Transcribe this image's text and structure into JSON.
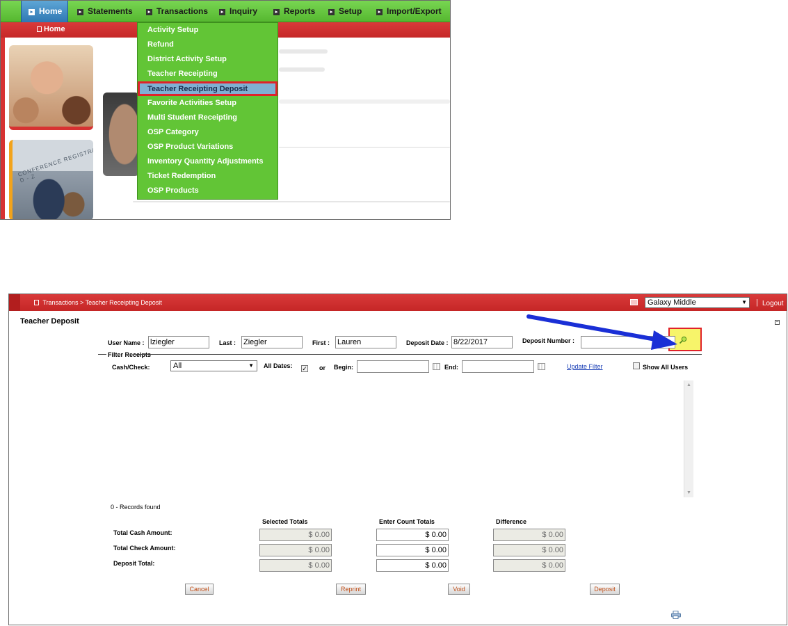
{
  "top": {
    "nav": [
      {
        "label": "Home",
        "active": true
      },
      {
        "label": "Statements"
      },
      {
        "label": "Transactions"
      },
      {
        "label": "Inquiry"
      },
      {
        "label": "Reports"
      },
      {
        "label": "Setup"
      },
      {
        "label": "Import/Export"
      }
    ],
    "breadcrumb": "Home",
    "photo_text": "CONFERENCE REGISTRATION",
    "photo_text_sub": "D - Z",
    "menu": [
      "Activity Setup",
      "Refund",
      "District Activity Setup",
      "Teacher Receipting",
      "Teacher Receipting Deposit",
      "Favorite Activities Setup",
      "Multi Student Receipting",
      "OSP Category",
      "OSP Product Variations",
      "Inventory Quantity Adjustments",
      "Ticket Redemption",
      "OSP Products"
    ],
    "menu_selected_index": 4
  },
  "bottom": {
    "breadcrumb": [
      "Transactions",
      ">",
      "Teacher Receipting Deposit"
    ],
    "school": "Galaxy Middle",
    "separator": "|",
    "logout": "Logout",
    "title": "Teacher Deposit",
    "form": {
      "user_name_label": "User Name :",
      "user_name": "lziegler",
      "last_label": "Last :",
      "last": "Ziegler",
      "first_label": "First :",
      "first": "Lauren",
      "deposit_date_label": "Deposit Date :",
      "deposit_date": "8/22/2017",
      "deposit_number_label": "Deposit Number :",
      "deposit_number": ""
    },
    "filter": {
      "legend": "Filter Receipts",
      "cash_check_label": "Cash/Check:",
      "cash_check_value": "All",
      "all_dates_label": "All Dates:",
      "all_dates_checked": true,
      "or_label": "or",
      "begin_label": "Begin:",
      "end_label": "End:",
      "update_filter": "Update Filter",
      "show_all_users": "Show All Users"
    },
    "records_found": "0 - Records found",
    "totals": {
      "col_selected": "Selected Totals",
      "col_enter": "Enter Count Totals",
      "col_diff": "Difference",
      "rows": [
        {
          "label": "Total Cash Amount:",
          "selected": "$ 0.00",
          "enter": "$ 0.00",
          "diff": "$ 0.00"
        },
        {
          "label": "Total Check Amount:",
          "selected": "$ 0.00",
          "enter": "$ 0.00",
          "diff": "$ 0.00"
        },
        {
          "label": "Deposit Total:",
          "selected": "$ 0.00",
          "enter": "$ 0.00",
          "diff": "$ 0.00"
        }
      ]
    },
    "buttons": {
      "cancel": "Cancel",
      "reprint": "Reprint",
      "void": "Void",
      "deposit": "Deposit"
    }
  },
  "colors": {
    "nav_green": "#62c536",
    "header_red": "#d93a3a",
    "highlight_yellow": "#f7f46a",
    "annotation_red": "#e0222a",
    "annotation_blue": "#1a2fd6"
  }
}
